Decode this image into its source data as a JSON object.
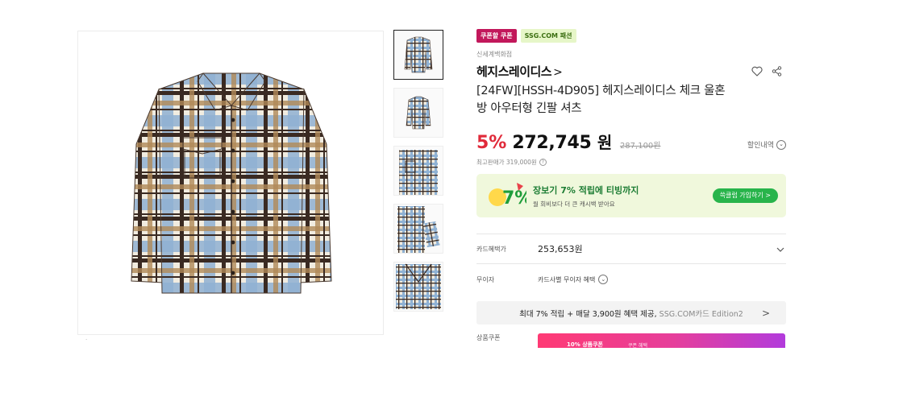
{
  "badges": [
    {
      "label": "쿠폰할 쿠폰",
      "color": "#c2185b"
    },
    {
      "label": "SSG.COM 패션",
      "color": "#e6f6c8"
    }
  ],
  "store": "신세계백화점",
  "brand": "헤지스레이디스",
  "brand_chevron": ">",
  "title_line1": "[24FW][HSSH-4D905] 헤지스레이디스 체크 울혼",
  "title_line2": "방 아우터형 긴팔 셔츠",
  "price": {
    "discount": "5%",
    "amount": "272,745",
    "unit": "원",
    "original": "287,100원",
    "discount_detail": "할인내역",
    "max_sale_label": "최고판매가 319,000원"
  },
  "promo": {
    "title": "장보기 7% 적립에 티빙까지",
    "subtitle": "월 회비보다 더 큰 캐시백 받아요",
    "button": "쓱클럽 가입하기 >",
    "logo_text": "7%"
  },
  "rows": [
    {
      "label": "카드혜택가",
      "value": "253,653원"
    },
    {
      "label": "무이자",
      "value": "카드사별 무이자 혜택"
    }
  ],
  "benefit_bar": {
    "text": "최대 7% 적립 + 매달 3,900원 혜택 제공,",
    "light": "SSG.COM카드 Edition2",
    "chevron": ">"
  },
  "coupon": {
    "label": "상품쿠폰",
    "button_left": "10% 상품쿠폰",
    "button_right": "쿠폰 혜택"
  },
  "gallery": {
    "thumb_count": 5,
    "main_image": "plaid-shirt-image",
    "colors": {
      "cream": "#f1ece0",
      "blue": "#8fb1d3",
      "brown": "#3a2a22",
      "tan": "#b08a57"
    }
  },
  "colors": {
    "accent_red": "#e02a3a",
    "accent_green": "#28b44b",
    "promo_bg": "#f0f8dc",
    "coupon_gradient": [
      "#ff3a74",
      "#b23bdc"
    ]
  },
  "icons": [
    "heart-icon",
    "share-icon",
    "chevron-down-icon",
    "question-icon",
    "chevron-right-icon"
  ]
}
